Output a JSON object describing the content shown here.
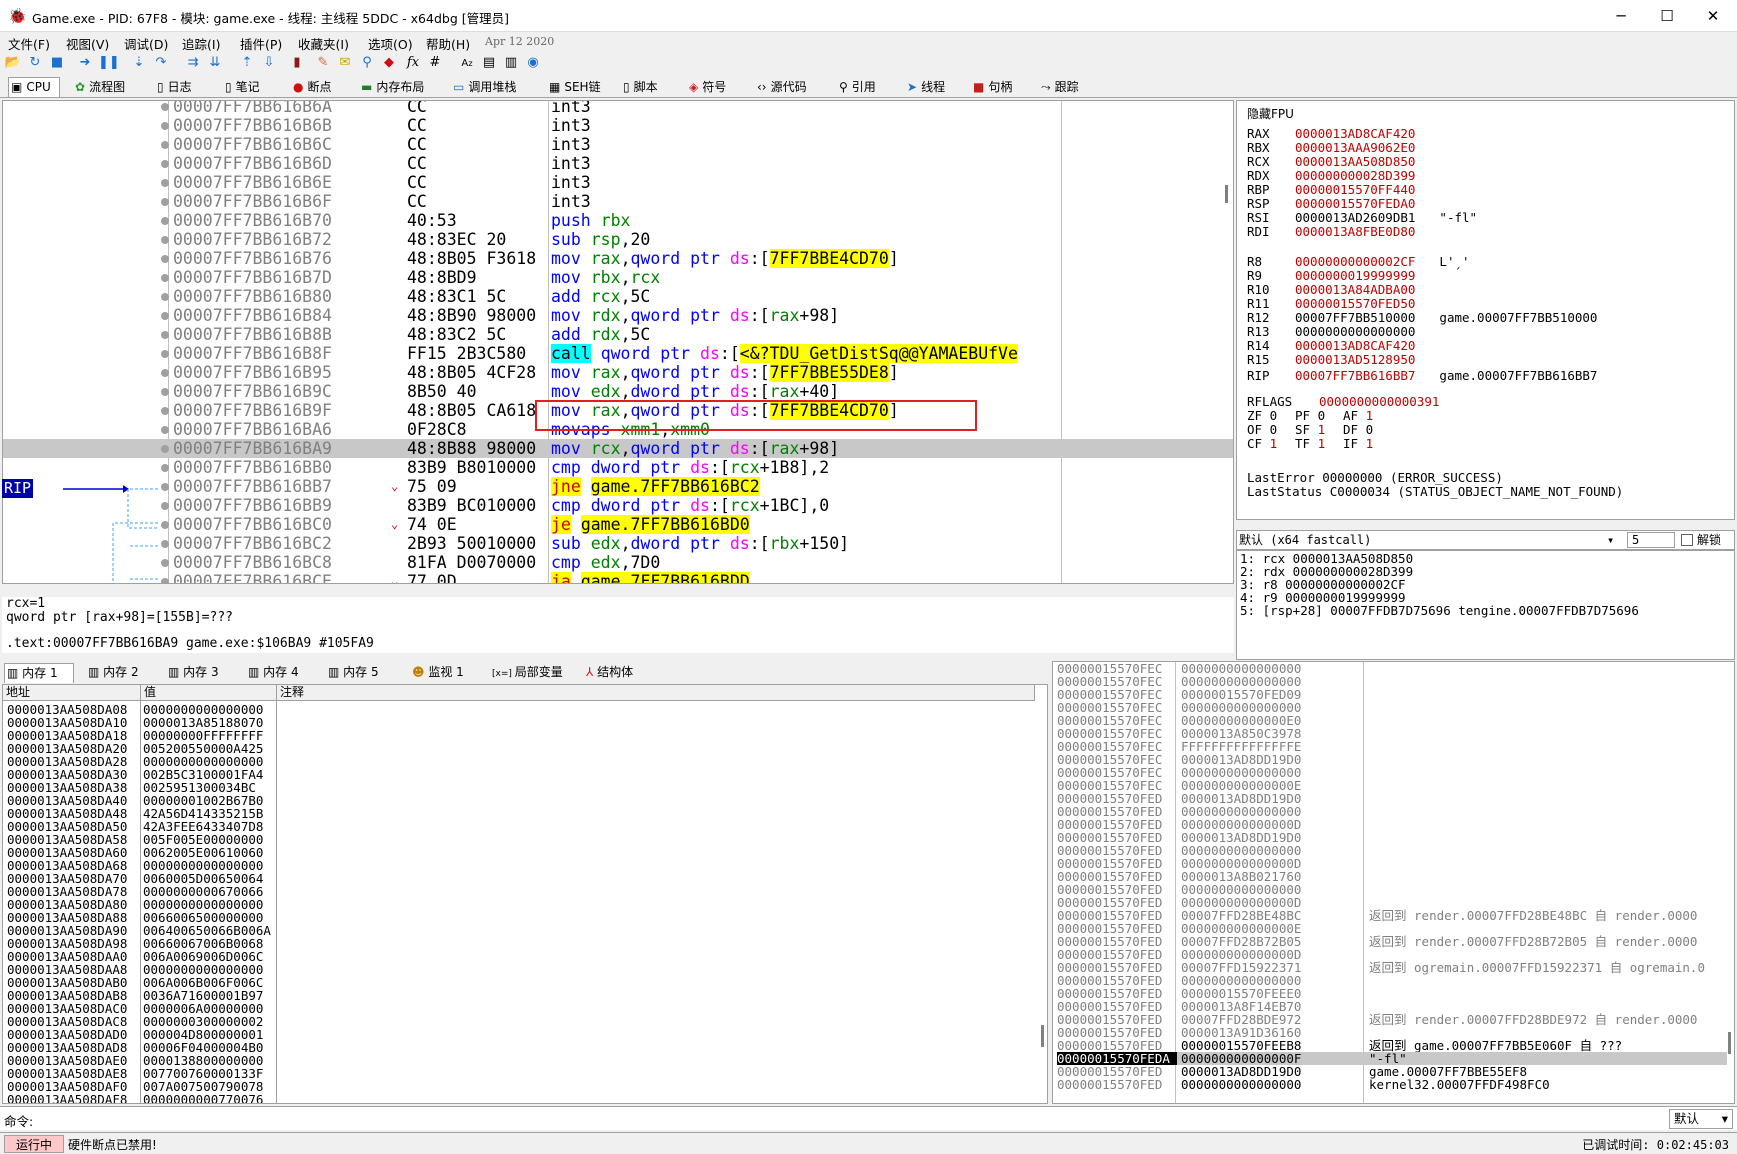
{
  "window": {
    "title": "Game.exe - PID: 67F8 - 模块: game.exe - 线程: 主线程 5DDC - x64dbg [管理员]",
    "minimize": "─",
    "maximize": "☐",
    "close": "✕"
  },
  "menu": {
    "items": [
      "文件(F)",
      "视图(V)",
      "调试(D)",
      "追踪(I)",
      "插件(P)",
      "收藏夹(I)",
      "选项(O)",
      "帮助(H)"
    ],
    "date": "Apr 12 2020"
  },
  "tabs": [
    "CPU",
    "流程图",
    "日志",
    "笔记",
    "断点",
    "内存布局",
    "调用堆栈",
    "SEH链",
    "脚本",
    "符号",
    "源代码",
    "引用",
    "线程",
    "句柄",
    "跟踪"
  ],
  "disasm": {
    "rows": [
      {
        "addr": "00007FF7BB616B6A",
        "bytes": "CC",
        "ins": "int3"
      },
      {
        "addr": "00007FF7BB616B6B",
        "bytes": "CC",
        "ins": "int3"
      },
      {
        "addr": "00007FF7BB616B6C",
        "bytes": "CC",
        "ins": "int3"
      },
      {
        "addr": "00007FF7BB616B6D",
        "bytes": "CC",
        "ins": "int3"
      },
      {
        "addr": "00007FF7BB616B6E",
        "bytes": "CC",
        "ins": "int3"
      },
      {
        "addr": "00007FF7BB616B6F",
        "bytes": "CC",
        "ins": "int3"
      },
      {
        "addr": "00007FF7BB616B70",
        "bytes": "40:53",
        "ins": "push rbx"
      },
      {
        "addr": "00007FF7BB616B72",
        "bytes": "48:83EC 20",
        "ins": "sub rsp,20"
      },
      {
        "addr": "00007FF7BB616B76",
        "bytes": "48:8B05 F3618",
        "ins": "mov rax,qword ptr ds:[7FF7BBE4CD70]"
      },
      {
        "addr": "00007FF7BB616B7D",
        "bytes": "48:8BD9",
        "ins": "mov rbx,rcx"
      },
      {
        "addr": "00007FF7BB616B80",
        "bytes": "48:83C1 5C",
        "ins": "add rcx,5C"
      },
      {
        "addr": "00007FF7BB616B84",
        "bytes": "48:8B90 98000",
        "ins": "mov rdx,qword ptr ds:[rax+98]"
      },
      {
        "addr": "00007FF7BB616B8B",
        "bytes": "48:83C2 5C",
        "ins": "add rdx,5C"
      },
      {
        "addr": "00007FF7BB616B8F",
        "bytes": "FF15 2B3C580",
        "ins": "call qword ptr ds:[<&?TDU_GetDistSq@@YAMAEBUfVe"
      },
      {
        "addr": "00007FF7BB616B95",
        "bytes": "48:8B05 4CF28",
        "ins": "mov rax,qword ptr ds:[7FF7BBE55DE8]"
      },
      {
        "addr": "00007FF7BB616B9C",
        "bytes": "8B50 40",
        "ins": "mov edx,dword ptr ds:[rax+40]"
      },
      {
        "addr": "00007FF7BB616B9F",
        "bytes": "48:8B05 CA618",
        "ins": "mov rax,qword ptr ds:[7FF7BBE4CD70]"
      },
      {
        "addr": "00007FF7BB616BA6",
        "bytes": "0F28C8",
        "ins": "movaps xmm1,xmm0"
      },
      {
        "addr": "00007FF7BB616BA9",
        "bytes": "48:8B88 98000",
        "ins": "mov rcx,qword ptr ds:[rax+98]"
      },
      {
        "addr": "00007FF7BB616BB0",
        "bytes": "83B9 B8010000",
        "ins": "cmp dword ptr ds:[rcx+1B8],2"
      },
      {
        "addr": "00007FF7BB616BB7",
        "bytes": "75 09",
        "ins": "jne game.7FF7BB616BC2"
      },
      {
        "addr": "00007FF7BB616BB9",
        "bytes": "83B9 BC010000",
        "ins": "cmp dword ptr ds:[rcx+1BC],0"
      },
      {
        "addr": "00007FF7BB616BC0",
        "bytes": "74 0E",
        "ins": "je game.7FF7BB616BD0"
      },
      {
        "addr": "00007FF7BB616BC2",
        "bytes": "2B93 50010000",
        "ins": "sub edx,dword ptr ds:[rbx+150]"
      },
      {
        "addr": "00007FF7BB616BC8",
        "bytes": "81FA D0070000",
        "ins": "cmp edx,7D0"
      },
      {
        "addr": "00007FF7BB616BCE",
        "bytes": "77 0D",
        "ins": "ja game.7FF7BB616BDD"
      }
    ],
    "rip_label": "RIP"
  },
  "info": {
    "line1": "rcx=1",
    "line2": "qword ptr [rax+98]=[155B]=???",
    "line3": ".text:00007FF7BB616BA9 game.exe:$106BA9 #105FA9"
  },
  "registers": {
    "header": "隐藏FPU",
    "gp": [
      {
        "name": "RAX",
        "value": "0000013AD8CAF420",
        "comment": ""
      },
      {
        "name": "RBX",
        "value": "0000013AAA9062E0",
        "comment": ""
      },
      {
        "name": "RCX",
        "value": "0000013AA508D850",
        "comment": ""
      },
      {
        "name": "RDX",
        "value": "000000000028D399",
        "comment": ""
      },
      {
        "name": "RBP",
        "value": "00000015570FF440",
        "comment": ""
      },
      {
        "name": "RSP",
        "value": "00000015570FEDA0",
        "comment": ""
      },
      {
        "name": "RSI",
        "value": "0000013AD2609DB1",
        "comment": "\"-fl\""
      },
      {
        "name": "RDI",
        "value": "0000013A8FBE0D80",
        "comment": ""
      }
    ],
    "ext": [
      {
        "name": "R8",
        "value": "00000000000002CF",
        "comment": "L'ˏ'"
      },
      {
        "name": "R9",
        "value": "0000000019999999",
        "comment": ""
      },
      {
        "name": "R10",
        "value": "0000013A84ADBA00",
        "comment": ""
      },
      {
        "name": "R11",
        "value": "00000015570FED50",
        "comment": ""
      },
      {
        "name": "R12",
        "value": "00007FF7BB510000",
        "comment": "game.00007FF7BB510000"
      },
      {
        "name": "R13",
        "value": "0000000000000000",
        "comment": ""
      },
      {
        "name": "R14",
        "value": "0000013AD8CAF420",
        "comment": ""
      },
      {
        "name": "R15",
        "value": "0000013AD5128950",
        "comment": ""
      }
    ],
    "rip": {
      "name": "RIP",
      "value": "00007FF7BB616BB7",
      "comment": "game.00007FF7BB616BB7"
    },
    "rflags_label": "RFLAGS",
    "rflags": "0000000000000391",
    "flags": [
      [
        "ZF",
        "0",
        "PF",
        "0",
        "AF",
        "1"
      ],
      [
        "OF",
        "0",
        "SF",
        "1",
        "DF",
        "0"
      ],
      [
        "CF",
        "1",
        "TF",
        "1",
        "IF",
        "1"
      ]
    ],
    "lasterror": "LastError  00000000 (ERROR_SUCCESS)",
    "laststatus": "LastStatus C0000034 (STATUS_OBJECT_NAME_NOT_FOUND)"
  },
  "callconv": {
    "value": "默认 (x64 fastcall)",
    "count": "5",
    "unlock": "解锁"
  },
  "args": [
    "1: rcx 0000013AA508D850",
    "2: rdx 000000000028D399",
    "3: r8 00000000000002CF",
    "4: r9 0000000019999999",
    "5: [rsp+28] 00007FFDB7D75696 tengine.00007FFDB7D75696"
  ],
  "memtabs": [
    "内存 1",
    "内存 2",
    "内存 3",
    "内存 4",
    "内存 5",
    "监视 1",
    "局部变量",
    "结构体"
  ],
  "dump": {
    "col_addr": "地址",
    "col_val": "值",
    "col_comment": "注释",
    "rows": [
      [
        "0000013AA508DA08",
        "0000000000000000"
      ],
      [
        "0000013AA508DA10",
        "0000013A85188070"
      ],
      [
        "0000013AA508DA18",
        "00000000FFFFFFFF"
      ],
      [
        "0000013AA508DA20",
        "005200550000A425"
      ],
      [
        "0000013AA508DA28",
        "0000000000000000"
      ],
      [
        "0000013AA508DA30",
        "002B5C3100001FA4"
      ],
      [
        "0000013AA508DA38",
        "0025951300034BC"
      ],
      [
        "0000013AA508DA40",
        "00000001002B67B0"
      ],
      [
        "0000013AA508DA48",
        "42A56D414335215B"
      ],
      [
        "0000013AA508DA50",
        "42A3FEE6433407D8"
      ],
      [
        "0000013AA508DA58",
        "005F005E00000000"
      ],
      [
        "0000013AA508DA60",
        "0062005E00610060"
      ],
      [
        "0000013AA508DA68",
        "0000000000000000"
      ],
      [
        "0000013AA508DA70",
        "0060005D00650064"
      ],
      [
        "0000013AA508DA78",
        "0000000000670066"
      ],
      [
        "0000013AA508DA80",
        "0000000000000000"
      ],
      [
        "0000013AA508DA88",
        "0066006500000000"
      ],
      [
        "0000013AA508DA90",
        "006400650066B006A"
      ],
      [
        "0000013AA508DA98",
        "00660067006B0068"
      ],
      [
        "0000013AA508DAA0",
        "006A0069006D006C"
      ],
      [
        "0000013AA508DAA8",
        "0000000000000000"
      ],
      [
        "0000013AA508DAB0",
        "006A006B006F006C"
      ],
      [
        "0000013AA508DAB8",
        "0036A71600001B97"
      ],
      [
        "0000013AA508DAC0",
        "0000006A00000000"
      ],
      [
        "0000013AA508DAC8",
        "0000000300000002"
      ],
      [
        "0000013AA508DAD0",
        "000004D800000001"
      ],
      [
        "0000013AA508DAD8",
        "00006F04000004B0"
      ],
      [
        "0000013AA508DAE0",
        "0000138800000000"
      ],
      [
        "0000013AA508DAE8",
        "007700760000133F"
      ],
      [
        "0000013AA508DAF0",
        "007A007500790078"
      ],
      [
        "0000013AA508DAF8",
        "0000000000770076"
      ]
    ]
  },
  "stack": {
    "rows": [
      [
        "00000015570FEC",
        "0000000000000000",
        ""
      ],
      [
        "00000015570FEC",
        "0000000000000000",
        ""
      ],
      [
        "00000015570FEC",
        "00000015570FED09",
        ""
      ],
      [
        "00000015570FEC",
        "0000000000000000",
        ""
      ],
      [
        "00000015570FEC",
        "00000000000000E0",
        ""
      ],
      [
        "00000015570FEC",
        "0000013A850C3978",
        ""
      ],
      [
        "00000015570FEC",
        "FFFFFFFFFFFFFFFE",
        ""
      ],
      [
        "00000015570FEC",
        "0000013AD8DD19D0",
        ""
      ],
      [
        "00000015570FEC",
        "0000000000000000",
        ""
      ],
      [
        "00000015570FEC",
        "000000000000000E",
        ""
      ],
      [
        "00000015570FED",
        "0000013AD8DD19D0",
        ""
      ],
      [
        "00000015570FED",
        "0000000000000000",
        ""
      ],
      [
        "00000015570FED",
        "000000000000000D",
        ""
      ],
      [
        "00000015570FED",
        "0000013AD8DD19D0",
        ""
      ],
      [
        "00000015570FED",
        "0000000000000000",
        ""
      ],
      [
        "00000015570FED",
        "000000000000000D",
        ""
      ],
      [
        "00000015570FED",
        "0000013A8B021760",
        ""
      ],
      [
        "00000015570FED",
        "0000000000000000",
        ""
      ],
      [
        "00000015570FED",
        "000000000000000D",
        ""
      ],
      [
        "00000015570FED",
        "00007FFD28BE48BC",
        "返回到 render.00007FFD28BE48BC 自 render.0000"
      ],
      [
        "00000015570FED",
        "000000000000000E",
        ""
      ],
      [
        "00000015570FED",
        "00007FFD28B72B05",
        "返回到 render.00007FFD28B72B05 自 render.0000"
      ],
      [
        "00000015570FED",
        "000000000000000D",
        ""
      ],
      [
        "00000015570FED",
        "00007FFD15922371",
        "返回到 ogremain.00007FFD15922371 自 ogremain.0"
      ],
      [
        "00000015570FED",
        "0000000000000000",
        ""
      ],
      [
        "00000015570FED",
        "00000015570FEEE0",
        ""
      ],
      [
        "00000015570FED",
        "0000013A8F14EB70",
        ""
      ],
      [
        "00000015570FED",
        "00007FFD28BDE972",
        "返回到 render.00007FFD28BDE972 自 render.0000"
      ],
      [
        "00000015570FED",
        "0000013A91D36160",
        ""
      ],
      [
        "00000015570FED",
        "00000015570FEEB8",
        "返回到 game.00007FF7BB5E060F 自 ???"
      ],
      [
        "00000015570FEDA",
        "000000000000000F",
        "\"-fl\""
      ],
      [
        "00000015570FED",
        "0000013AD8DD19D0",
        "game.00007FF7BBE55EF8"
      ],
      [
        "00000015570FED",
        "0000000000000000",
        "kernel32.00007FFDF498FC0"
      ]
    ]
  },
  "cmd": {
    "label": "命令:",
    "mode": "默认"
  },
  "status": {
    "state": "运行中",
    "message": "硬件断点已禁用!",
    "time": "已调试时间: 0:02:45:03"
  }
}
